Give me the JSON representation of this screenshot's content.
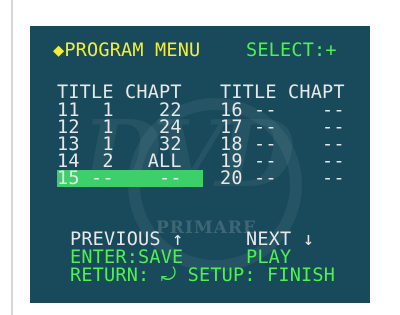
{
  "menu": {
    "title": "◆PROGRAM MENU",
    "select_hint": "SELECT:+"
  },
  "table": {
    "headers": {
      "left": "TITLE CHAPT",
      "right": "TITLE CHAPT"
    },
    "left_rows": [
      "11  1    22",
      "12  1    24",
      "13  1    32",
      "14  2   ALL",
      "15 --    --"
    ],
    "right_rows": [
      "16 --    --",
      "17 --    --",
      "18 --    --",
      "19 --    --",
      "20 --    --"
    ]
  },
  "watermark": "PRIMARE",
  "footer": {
    "previous": "PREVIOUS ↑",
    "next": "NEXT ↓",
    "enter_save": "ENTER:SAVE",
    "play": "PLAY",
    "return_setup": "RETURN: ⤾ SETUP: FINISH"
  },
  "colors": {
    "screen_bg": "#184a5b",
    "title_yellow": "#f3ee3a",
    "accent_green": "#4ef24e",
    "row_highlight": "#3ccf6a"
  }
}
